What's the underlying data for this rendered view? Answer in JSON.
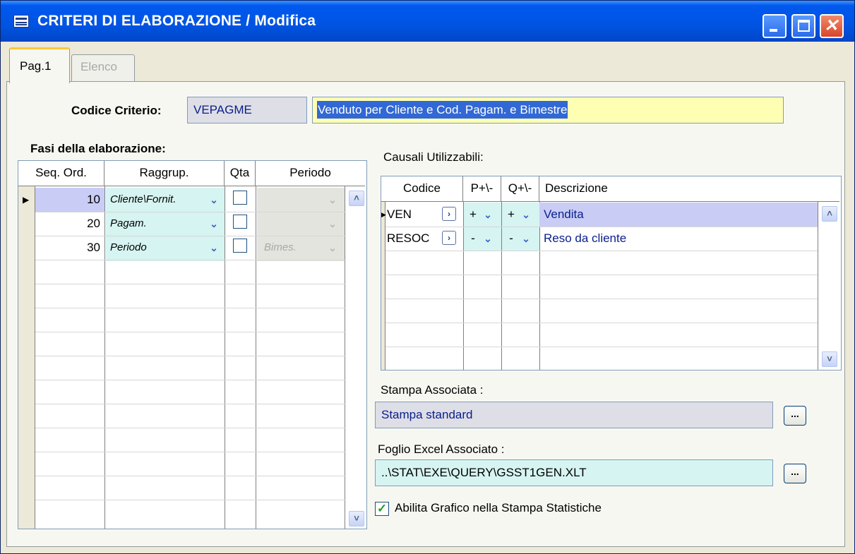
{
  "window": {
    "title": "CRITERI DI ELABORAZIONE / Modifica",
    "minimize_label": "_",
    "maximize_label": "□",
    "close_label": "✕"
  },
  "tabs": [
    {
      "label": "Pag.1",
      "active": true
    },
    {
      "label": "Elenco",
      "active": false
    }
  ],
  "criterio": {
    "label": "Codice Criterio:",
    "code": "VEPAGME",
    "description": "Venduto per Cliente e Cod. Pagam. e Bimestre"
  },
  "fasi": {
    "title": "Fasi della elaborazione:",
    "columns": [
      "Seq. Ord.",
      "Raggrup.",
      "Qta",
      "Periodo"
    ],
    "rows": [
      {
        "seq": "10",
        "raggrup": "Cliente\\Fornit.",
        "qta": false,
        "periodo": ""
      },
      {
        "seq": "20",
        "raggrup": "Pagam.",
        "qta": false,
        "periodo": ""
      },
      {
        "seq": "30",
        "raggrup": "Periodo",
        "qta": false,
        "periodo": "Bimes."
      }
    ]
  },
  "causali": {
    "title": "Causali Utilizzabili:",
    "columns": [
      "Codice",
      "P+\\-",
      "Q+\\-",
      "Descrizione"
    ],
    "rows": [
      {
        "codice": "VEN",
        "p": "+",
        "q": "+",
        "descrizione": "Vendita"
      },
      {
        "codice": "RESOC",
        "p": "-",
        "q": "-",
        "descrizione": "Reso da cliente"
      }
    ]
  },
  "stampa": {
    "label": "Stampa  Associata :",
    "value": "Stampa standard",
    "button": "..."
  },
  "excel": {
    "label": "Foglio Excel Associato :",
    "value": "..\\STAT\\EXE\\QUERY\\GSST1GEN.XLT",
    "button": "..."
  },
  "grafico": {
    "label": "Abilita Grafico nella Stampa Statistiche",
    "checked": true
  },
  "colors": {
    "title_bar": "#0054E3",
    "panel": "#F7F7F2",
    "selected_row": "#C9CDF5",
    "combo_bg": "#D6F4F1",
    "code_bg": "#DEDEE6",
    "description_bg": "#FFFFB4",
    "excel_bg": "#D6F4F1"
  }
}
